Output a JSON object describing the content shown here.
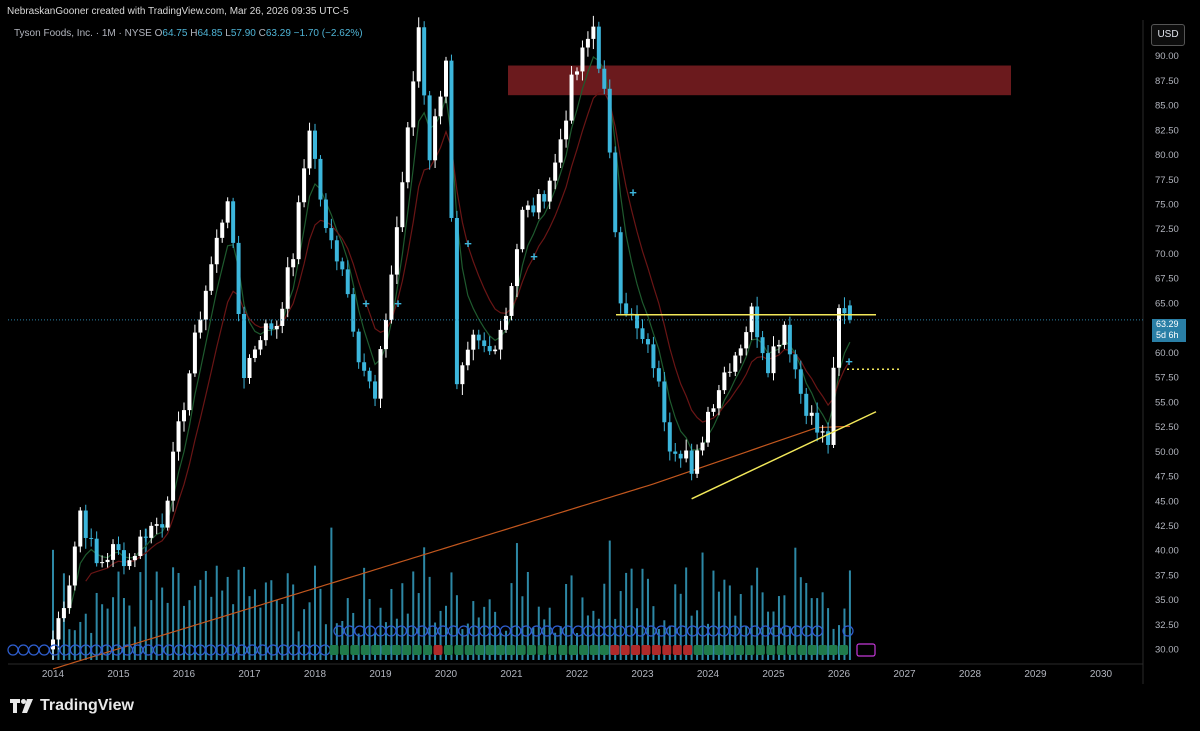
{
  "header": {
    "author_line": "NebraskanGooner created with TradingView.com, Mar 26, 2026 09:35 UTC-5"
  },
  "legend": {
    "symbol": "Tyson Foods, Inc. · 1M · NYSE",
    "open_label": "O",
    "open": "64.75",
    "high_label": "H",
    "high": "64.85",
    "low_label": "L",
    "low": "57.90",
    "close_label": "C",
    "close": "63.29",
    "change": "−1.70 (−2.62%)"
  },
  "currency": "USD",
  "price_tag": {
    "price": "63.29",
    "countdown": "5d 6h"
  },
  "brand": {
    "name": "TradingView"
  },
  "colors": {
    "up": "#ffffff",
    "down": "#3cb6dc",
    "ema_short": "#1e5a2e",
    "ema_mid": "#6a1515",
    "ma_long": "#c2571e",
    "zone": "#6b1a1d",
    "resistance": "#f2e85a",
    "volume": "#3cb6dc",
    "div_badge": "#2f5fd0",
    "earn_up": "#1f7a4a",
    "earn_down": "#b02a2a"
  },
  "chart_data": {
    "type": "candlestick",
    "timeframe": "1M",
    "x_ticks": [
      "2014",
      "2015",
      "2016",
      "2017",
      "2018",
      "2019",
      "2020",
      "2021",
      "2022",
      "2023",
      "2024",
      "2025",
      "2026",
      "2027",
      "2028",
      "2029",
      "2030"
    ],
    "y_ticks": [
      "30.00",
      "32.50",
      "35.00",
      "37.50",
      "40.00",
      "42.50",
      "45.00",
      "47.50",
      "50.00",
      "52.50",
      "55.00",
      "57.50",
      "60.00",
      "62.50",
      "65.00",
      "67.50",
      "70.00",
      "72.50",
      "75.00",
      "77.50",
      "80.00",
      "82.50",
      "85.00",
      "87.50",
      "90.00"
    ],
    "ylim": [
      28.5,
      93.5
    ],
    "anchors": [
      [
        "2014-01",
        31
      ],
      [
        "2014-04",
        37
      ],
      [
        "2014-06",
        44
      ],
      [
        "2014-09",
        38.5
      ],
      [
        "2014-12",
        40
      ],
      [
        "2015-03",
        39
      ],
      [
        "2015-06",
        42
      ],
      [
        "2015-09",
        43
      ],
      [
        "2015-12",
        52
      ],
      [
        "2016-04",
        64
      ],
      [
        "2016-09",
        76
      ],
      [
        "2016-12",
        58
      ],
      [
        "2017-03",
        62
      ],
      [
        "2017-06",
        63
      ],
      [
        "2017-09",
        70
      ],
      [
        "2017-12",
        83
      ],
      [
        "2018-03",
        72
      ],
      [
        "2018-06",
        69
      ],
      [
        "2018-09",
        60
      ],
      [
        "2018-12",
        55
      ],
      [
        "2019-03",
        68
      ],
      [
        "2019-06",
        82
      ],
      [
        "2019-08",
        93
      ],
      [
        "2019-10",
        80
      ],
      [
        "2020-01",
        90
      ],
      [
        "2020-03",
        56
      ],
      [
        "2020-06",
        61
      ],
      [
        "2020-09",
        60
      ],
      [
        "2020-12",
        64
      ],
      [
        "2021-03",
        74
      ],
      [
        "2021-06",
        75
      ],
      [
        "2021-09",
        79
      ],
      [
        "2021-12",
        87
      ],
      [
        "2022-04",
        93
      ],
      [
        "2022-06",
        86
      ],
      [
        "2022-09",
        66
      ],
      [
        "2022-12",
        62
      ],
      [
        "2023-03",
        59
      ],
      [
        "2023-06",
        51
      ],
      [
        "2023-09",
        50
      ],
      [
        "2023-10",
        47
      ],
      [
        "2024-01",
        54
      ],
      [
        "2024-04",
        58
      ],
      [
        "2024-07",
        61
      ],
      [
        "2024-09",
        64
      ],
      [
        "2024-12",
        59
      ],
      [
        "2025-03",
        63
      ],
      [
        "2025-06",
        56
      ],
      [
        "2025-09",
        52
      ],
      [
        "2025-11",
        51
      ],
      [
        "2026-01",
        64
      ],
      [
        "2026-03",
        63.3
      ]
    ],
    "zone": {
      "x_from": "2021-01",
      "x_to": "2028-06",
      "y_from": 86,
      "y_to": 89
    },
    "resistance": {
      "x_from": "2022-08",
      "x_to": "2026-06",
      "y": 63.8
    },
    "support_dotted": {
      "x_from": "2026-02",
      "x_to": "2026-10",
      "y": 58.3
    },
    "trendline": {
      "x_from": "2023-10",
      "y_from": 45.2,
      "x_to": "2026-06",
      "y_to": 54
    },
    "current_price": 63.29
  }
}
